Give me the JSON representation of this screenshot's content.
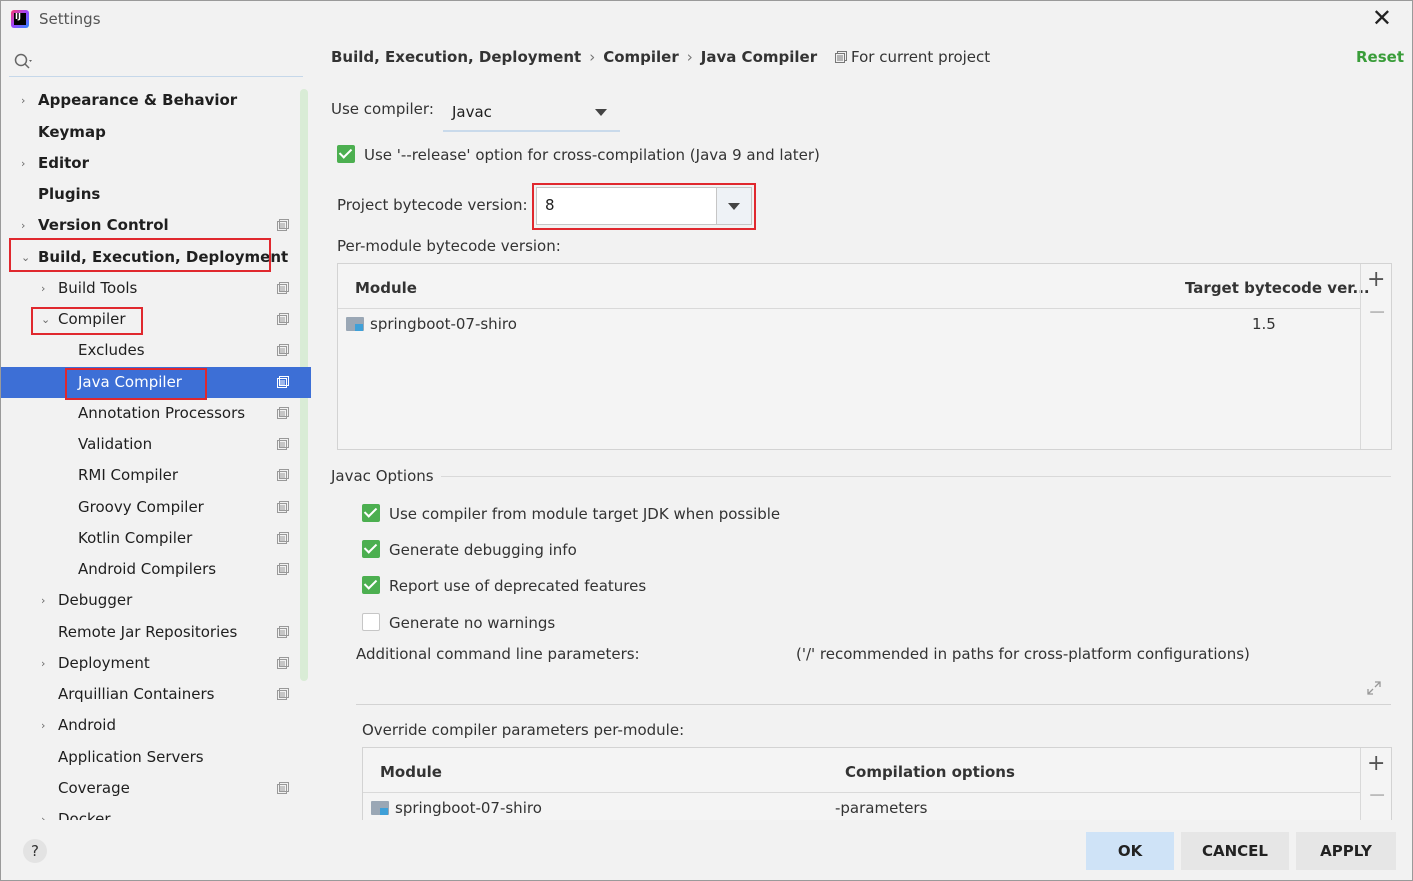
{
  "window": {
    "title": "Settings"
  },
  "sidebar": {
    "items": [
      {
        "label": "Appearance & Behavior",
        "arrow": "›",
        "bold": true
      },
      {
        "label": "Keymap",
        "arrow": "",
        "bold": true
      },
      {
        "label": "Editor",
        "arrow": "›",
        "bold": true
      },
      {
        "label": "Plugins",
        "arrow": "",
        "bold": true
      },
      {
        "label": "Version Control",
        "arrow": "›",
        "bold": true
      },
      {
        "label": "Build, Execution, Deployment",
        "arrow": "⌄",
        "bold": true
      },
      {
        "label": "Build Tools",
        "arrow": "›"
      },
      {
        "label": "Compiler",
        "arrow": "⌄"
      },
      {
        "label": "Excludes",
        "arrow": ""
      },
      {
        "label": "Java Compiler",
        "arrow": "",
        "selected": true
      },
      {
        "label": "Annotation Processors",
        "arrow": ""
      },
      {
        "label": "Validation",
        "arrow": ""
      },
      {
        "label": "RMI Compiler",
        "arrow": ""
      },
      {
        "label": "Groovy Compiler",
        "arrow": ""
      },
      {
        "label": "Kotlin Compiler",
        "arrow": ""
      },
      {
        "label": "Android Compilers",
        "arrow": ""
      },
      {
        "label": "Debugger",
        "arrow": "›"
      },
      {
        "label": "Remote Jar Repositories",
        "arrow": ""
      },
      {
        "label": "Deployment",
        "arrow": "›"
      },
      {
        "label": "Arquillian Containers",
        "arrow": ""
      },
      {
        "label": "Android",
        "arrow": "›"
      },
      {
        "label": "Application Servers",
        "arrow": ""
      },
      {
        "label": "Coverage",
        "arrow": ""
      },
      {
        "label": "Docker",
        "arrow": "›"
      }
    ]
  },
  "breadcrumb": {
    "part1": "Build, Execution, Deployment",
    "part2": "Compiler",
    "part3": "Java Compiler",
    "sep": "›"
  },
  "scope_label": "For current project",
  "reset_label": "Reset",
  "compiler": {
    "use_compiler_label": "Use compiler:",
    "use_compiler_value": "Javac",
    "release_option_label": "Use '--release' option for cross-compilation (Java 9 and later)",
    "bytecode_label": "Project bytecode version:",
    "bytecode_value": "8",
    "per_module_label": "Per-module bytecode version:",
    "module_table": {
      "headers": [
        "Module",
        "Target bytecode ver..."
      ],
      "rows": [
        {
          "module": "springboot-07-shiro",
          "target": "1.5"
        }
      ]
    }
  },
  "javac": {
    "section_label": "Javac Options",
    "options": [
      {
        "label": "Use compiler from module target JDK when possible",
        "checked": true
      },
      {
        "label": "Generate debugging info",
        "checked": true
      },
      {
        "label": "Report use of deprecated features",
        "checked": true
      },
      {
        "label": "Generate no warnings",
        "checked": false
      }
    ],
    "additional_label": "Additional command line parameters:",
    "additional_hint": "('/' recommended in paths for cross-platform configurations)",
    "override_label": "Override compiler parameters per-module:",
    "override_table": {
      "headers": [
        "Module",
        "Compilation options"
      ],
      "rows": [
        {
          "module": "springboot-07-shiro",
          "options": "-parameters"
        }
      ]
    }
  },
  "tools": {
    "add": "+",
    "remove": "−"
  },
  "footer": {
    "help": "?",
    "ok": "OK",
    "cancel": "CANCEL",
    "apply": "APPLY"
  }
}
